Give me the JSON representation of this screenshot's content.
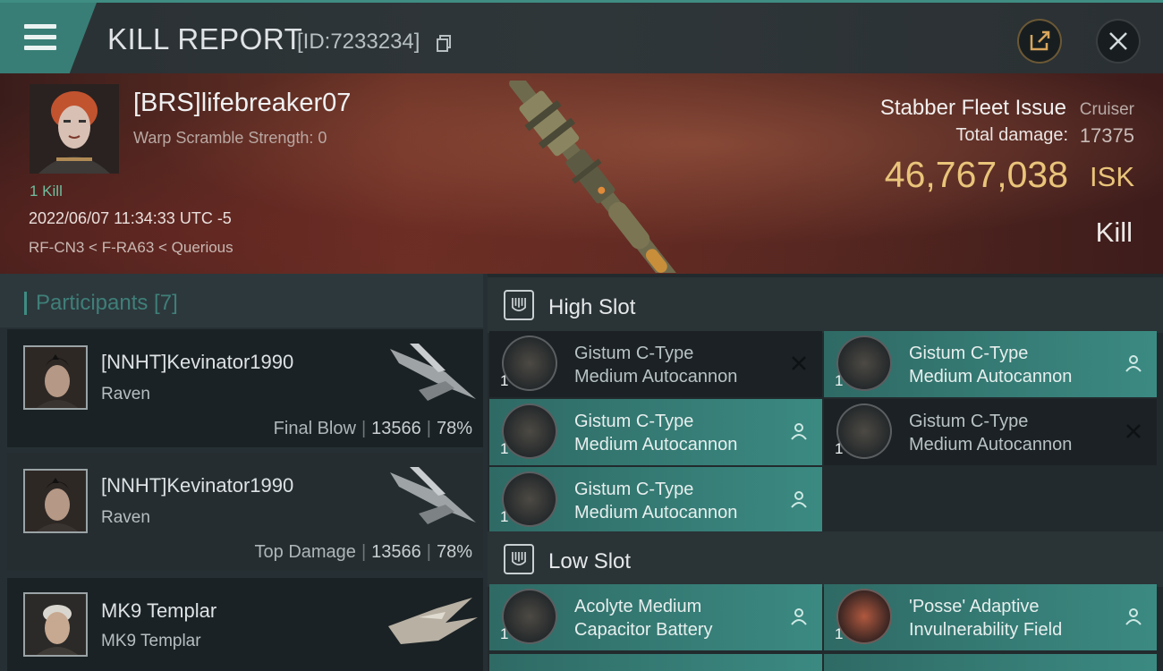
{
  "header": {
    "title": "KILL REPORT",
    "report_id": "[ID:7233234]",
    "menu_icon": "hamburger-icon",
    "share_icon": "share-icon",
    "close_icon": "close-icon",
    "accent_color": "#3f8d83"
  },
  "victim": {
    "name": "[BRS]lifebreaker07",
    "warp_scramble": "Warp Scramble Strength: 0",
    "kill_count": "1 Kill",
    "time": "2022/06/07 11:34:33 UTC -5",
    "location": "RF-CN3 < F-RA63 < Querious",
    "ship_name": "Stabber Fleet Issue",
    "ship_class": "Cruiser",
    "damage_label": "Total damage:",
    "damage_value": "17375",
    "isk_value": "46,767,038",
    "isk_unit": "ISK",
    "result": "Kill",
    "isk_color": "#e9c47a"
  },
  "participants": {
    "title": "Participants [7]",
    "rows": [
      {
        "name": "[NNHT]Kevinator1990",
        "ship": "Raven",
        "role": "Final Blow",
        "damage": "13566",
        "percent": "78%"
      },
      {
        "name": "[NNHT]Kevinator1990",
        "ship": "Raven",
        "role": "Top Damage",
        "damage": "13566",
        "percent": "78%"
      },
      {
        "name": "MK9 Templar",
        "ship": "MK9 Templar",
        "role": "",
        "damage": "",
        "percent": ""
      }
    ]
  },
  "fitting": {
    "high_slot_title": "High Slot",
    "low_slot_title": "Low Slot",
    "high_slot": [
      {
        "line1": "Gistum C-Type",
        "line2": "Medium Autocannon",
        "qty": "1",
        "state": "destroyed",
        "state_icon": "destroyed-x-icon"
      },
      {
        "line1": "Gistum C-Type",
        "line2": "Medium Autocannon",
        "qty": "1",
        "state": "dropped",
        "state_icon": "person-icon"
      },
      {
        "line1": "Gistum C-Type",
        "line2": "Medium Autocannon",
        "qty": "1",
        "state": "dropped",
        "state_icon": "person-icon"
      },
      {
        "line1": "Gistum C-Type",
        "line2": "Medium Autocannon",
        "qty": "1",
        "state": "destroyed",
        "state_icon": "destroyed-x-icon"
      },
      {
        "line1": "Gistum C-Type",
        "line2": "Medium Autocannon",
        "qty": "1",
        "state": "dropped",
        "state_icon": "person-icon"
      }
    ],
    "low_slot": [
      {
        "line1": "Acolyte Medium",
        "line2": "Capacitor Battery",
        "qty": "1",
        "state": "dropped",
        "state_icon": "person-icon"
      },
      {
        "line1": "'Posse' Adaptive",
        "line2": "Invulnerability Field",
        "qty": "1",
        "state": "dropped",
        "state_icon": "person-icon"
      }
    ],
    "dropped_color": "#3b8a82",
    "destroyed_color": "#1b2124"
  }
}
